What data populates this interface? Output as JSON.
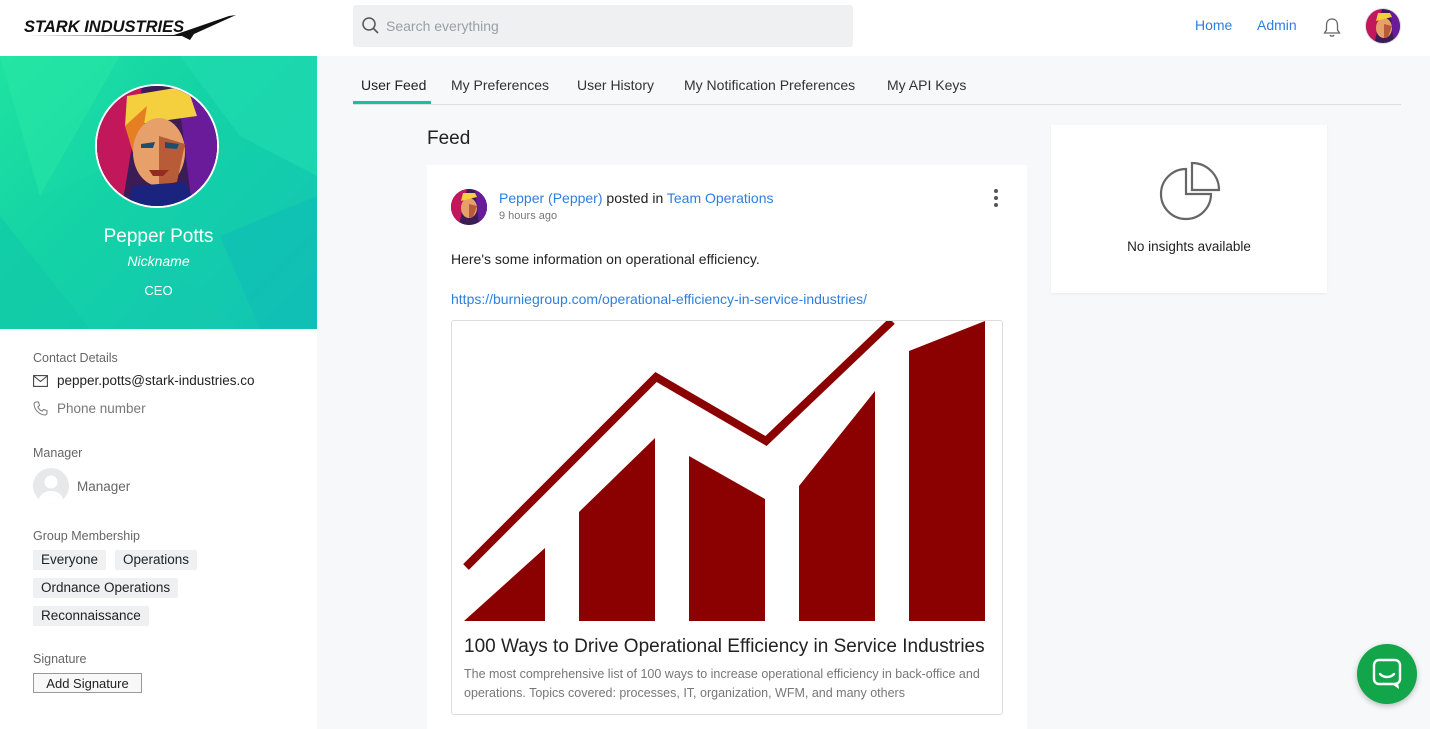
{
  "brand": {
    "logo_text": "STARK INDUSTRIES"
  },
  "search": {
    "placeholder": "Search everything"
  },
  "nav": {
    "home_label": "Home",
    "admin_label": "Admin"
  },
  "profile": {
    "name": "Pepper Potts",
    "nickname": "Nickname",
    "role": "CEO"
  },
  "contact": {
    "section_label": "Contact Details",
    "email": "pepper.potts@stark-industries.co",
    "phone_placeholder": "Phone number"
  },
  "manager": {
    "section_label": "Manager",
    "name": "Manager"
  },
  "groups": {
    "section_label": "Group Membership",
    "items": [
      "Everyone",
      "Operations",
      "Ordnance Operations",
      "Reconnaissance"
    ]
  },
  "signature": {
    "section_label": "Signature",
    "add_label": "Add Signature"
  },
  "tabs": [
    {
      "label": "User Feed",
      "active": true
    },
    {
      "label": "My Preferences",
      "active": false
    },
    {
      "label": "User History",
      "active": false
    },
    {
      "label": "My Notification Preferences",
      "active": false
    },
    {
      "label": "My API Keys",
      "active": false
    }
  ],
  "feed": {
    "title": "Feed",
    "post": {
      "author": "Pepper (Pepper)",
      "verb": "posted in",
      "channel": "Team Operations",
      "time": "9 hours ago",
      "text": "Here's some information on operational efficiency.",
      "url": "https://burniegroup.com/operational-efficiency-in-service-industries/",
      "card": {
        "title": "100 Ways to Drive Operational Efficiency in Service Industries",
        "description": "The most comprehensive list of 100 ways to increase operational efficiency in back-office and operations. Topics covered: processes, IT, organization, WFM, and many others"
      }
    }
  },
  "insights": {
    "empty_text": "No insights available"
  },
  "colors": {
    "accent": "#13c2a3",
    "link": "#2d7fe0",
    "chart_red": "#8b0000",
    "chat_green": "#12a54a"
  }
}
